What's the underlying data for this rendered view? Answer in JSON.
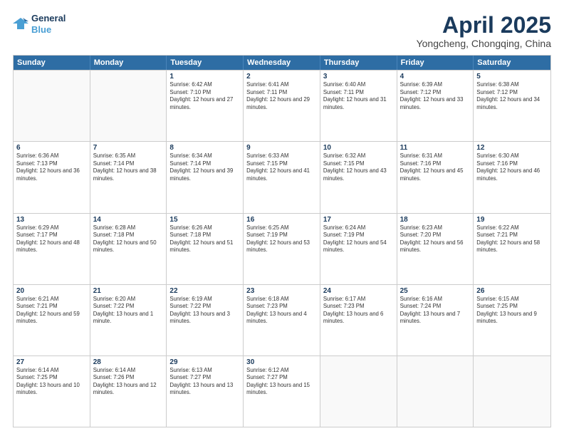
{
  "header": {
    "logo_line1": "General",
    "logo_line2": "Blue",
    "title": "April 2025",
    "subtitle": "Yongcheng, Chongqing, China"
  },
  "days_of_week": [
    "Sunday",
    "Monday",
    "Tuesday",
    "Wednesday",
    "Thursday",
    "Friday",
    "Saturday"
  ],
  "weeks": [
    [
      {
        "day": "",
        "empty": true
      },
      {
        "day": "",
        "empty": true
      },
      {
        "day": "1",
        "sunrise": "6:42 AM",
        "sunset": "7:10 PM",
        "daylight": "12 hours and 27 minutes."
      },
      {
        "day": "2",
        "sunrise": "6:41 AM",
        "sunset": "7:11 PM",
        "daylight": "12 hours and 29 minutes."
      },
      {
        "day": "3",
        "sunrise": "6:40 AM",
        "sunset": "7:11 PM",
        "daylight": "12 hours and 31 minutes."
      },
      {
        "day": "4",
        "sunrise": "6:39 AM",
        "sunset": "7:12 PM",
        "daylight": "12 hours and 33 minutes."
      },
      {
        "day": "5",
        "sunrise": "6:38 AM",
        "sunset": "7:12 PM",
        "daylight": "12 hours and 34 minutes."
      }
    ],
    [
      {
        "day": "6",
        "sunrise": "6:36 AM",
        "sunset": "7:13 PM",
        "daylight": "12 hours and 36 minutes."
      },
      {
        "day": "7",
        "sunrise": "6:35 AM",
        "sunset": "7:14 PM",
        "daylight": "12 hours and 38 minutes."
      },
      {
        "day": "8",
        "sunrise": "6:34 AM",
        "sunset": "7:14 PM",
        "daylight": "12 hours and 39 minutes."
      },
      {
        "day": "9",
        "sunrise": "6:33 AM",
        "sunset": "7:15 PM",
        "daylight": "12 hours and 41 minutes."
      },
      {
        "day": "10",
        "sunrise": "6:32 AM",
        "sunset": "7:15 PM",
        "daylight": "12 hours and 43 minutes."
      },
      {
        "day": "11",
        "sunrise": "6:31 AM",
        "sunset": "7:16 PM",
        "daylight": "12 hours and 45 minutes."
      },
      {
        "day": "12",
        "sunrise": "6:30 AM",
        "sunset": "7:16 PM",
        "daylight": "12 hours and 46 minutes."
      }
    ],
    [
      {
        "day": "13",
        "sunrise": "6:29 AM",
        "sunset": "7:17 PM",
        "daylight": "12 hours and 48 minutes."
      },
      {
        "day": "14",
        "sunrise": "6:28 AM",
        "sunset": "7:18 PM",
        "daylight": "12 hours and 50 minutes."
      },
      {
        "day": "15",
        "sunrise": "6:26 AM",
        "sunset": "7:18 PM",
        "daylight": "12 hours and 51 minutes."
      },
      {
        "day": "16",
        "sunrise": "6:25 AM",
        "sunset": "7:19 PM",
        "daylight": "12 hours and 53 minutes."
      },
      {
        "day": "17",
        "sunrise": "6:24 AM",
        "sunset": "7:19 PM",
        "daylight": "12 hours and 54 minutes."
      },
      {
        "day": "18",
        "sunrise": "6:23 AM",
        "sunset": "7:20 PM",
        "daylight": "12 hours and 56 minutes."
      },
      {
        "day": "19",
        "sunrise": "6:22 AM",
        "sunset": "7:21 PM",
        "daylight": "12 hours and 58 minutes."
      }
    ],
    [
      {
        "day": "20",
        "sunrise": "6:21 AM",
        "sunset": "7:21 PM",
        "daylight": "12 hours and 59 minutes."
      },
      {
        "day": "21",
        "sunrise": "6:20 AM",
        "sunset": "7:22 PM",
        "daylight": "13 hours and 1 minute."
      },
      {
        "day": "22",
        "sunrise": "6:19 AM",
        "sunset": "7:22 PM",
        "daylight": "13 hours and 3 minutes."
      },
      {
        "day": "23",
        "sunrise": "6:18 AM",
        "sunset": "7:23 PM",
        "daylight": "13 hours and 4 minutes."
      },
      {
        "day": "24",
        "sunrise": "6:17 AM",
        "sunset": "7:23 PM",
        "daylight": "13 hours and 6 minutes."
      },
      {
        "day": "25",
        "sunrise": "6:16 AM",
        "sunset": "7:24 PM",
        "daylight": "13 hours and 7 minutes."
      },
      {
        "day": "26",
        "sunrise": "6:15 AM",
        "sunset": "7:25 PM",
        "daylight": "13 hours and 9 minutes."
      }
    ],
    [
      {
        "day": "27",
        "sunrise": "6:14 AM",
        "sunset": "7:25 PM",
        "daylight": "13 hours and 10 minutes."
      },
      {
        "day": "28",
        "sunrise": "6:14 AM",
        "sunset": "7:26 PM",
        "daylight": "13 hours and 12 minutes."
      },
      {
        "day": "29",
        "sunrise": "6:13 AM",
        "sunset": "7:27 PM",
        "daylight": "13 hours and 13 minutes."
      },
      {
        "day": "30",
        "sunrise": "6:12 AM",
        "sunset": "7:27 PM",
        "daylight": "13 hours and 15 minutes."
      },
      {
        "day": "",
        "empty": true
      },
      {
        "day": "",
        "empty": true
      },
      {
        "day": "",
        "empty": true
      }
    ]
  ]
}
